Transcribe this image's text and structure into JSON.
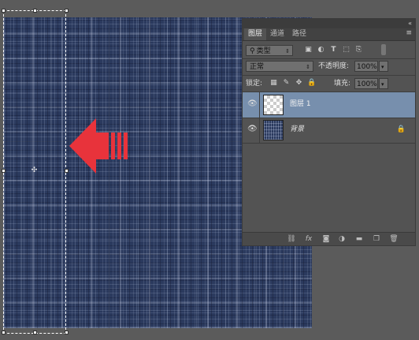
{
  "panel": {
    "collapse_glyph": "«",
    "menu_glyph": "≡",
    "tabs": [
      {
        "label": "图层",
        "active": true
      },
      {
        "label": "通道",
        "active": false
      },
      {
        "label": "路径",
        "active": false
      }
    ],
    "filter": {
      "label": "类型",
      "icons": [
        "image-filter-icon",
        "adjustment-filter-icon",
        "type-filter-icon",
        "shape-filter-icon",
        "smart-object-filter-icon"
      ]
    },
    "blend_mode": "正常",
    "opacity_label": "不透明度:",
    "opacity_value": "100%",
    "lock_label": "锁定:",
    "fill_label": "填充:",
    "fill_value": "100%",
    "layers": [
      {
        "name": "图层 1",
        "selected": true,
        "visible": true,
        "locked": false,
        "thumb": "transparent"
      },
      {
        "name": "背景",
        "selected": false,
        "visible": true,
        "locked": true,
        "thumb": "texture"
      }
    ],
    "bottom_icons": [
      "link-layers-icon",
      "fx-icon",
      "add-mask-icon",
      "adjustment-layer-icon",
      "new-group-icon",
      "new-layer-icon",
      "delete-layer-icon"
    ]
  },
  "colors": {
    "selected_layer": "#778fad",
    "arrow": "#e8333b",
    "panel_bg": "#535353"
  }
}
